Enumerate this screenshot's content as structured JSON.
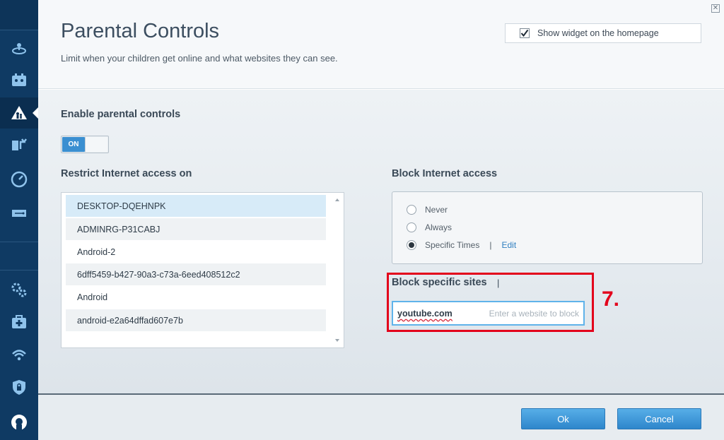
{
  "sidebar": {
    "items": [
      {
        "icon": "network-map-icon"
      },
      {
        "icon": "guest-access-icon"
      },
      {
        "icon": "parental-controls-icon",
        "active": true
      },
      {
        "icon": "media-prioritization-icon"
      },
      {
        "icon": "speed-test-icon"
      },
      {
        "icon": "external-storage-icon"
      },
      {
        "icon": "connectivity-settings-icon"
      },
      {
        "icon": "troubleshooting-icon"
      },
      {
        "icon": "wireless-icon"
      },
      {
        "icon": "security-icon"
      },
      {
        "icon": "linksys-logo-icon"
      }
    ]
  },
  "header": {
    "title": "Parental Controls",
    "subtitle": "Limit when your children get online and what websites they can see.",
    "widget_label": "Show widget on the homepage",
    "widget_checked": true
  },
  "enable": {
    "label": "Enable parental controls",
    "toggle_text": "ON"
  },
  "restrict": {
    "label": "Restrict Internet access on",
    "devices": [
      "DESKTOP-DQEHNPK",
      "ADMINRG-P31CABJ",
      "Android-2",
      "6dff5459-b427-90a3-c73a-6eed408512c2",
      "Android",
      "android-e2a64dffad607e7b"
    ],
    "selected_index": 0
  },
  "block": {
    "label": "Block Internet access",
    "options": [
      "Never",
      "Always",
      "Specific Times"
    ],
    "selected": "Specific Times",
    "edit_label": "Edit"
  },
  "sites": {
    "label": "Block specific sites",
    "cursor": "|",
    "value": "youtube.com",
    "placeholder": "Enter a website to block"
  },
  "annotation": {
    "step": "7."
  },
  "footer": {
    "ok_label": "Ok",
    "cancel_label": "Cancel"
  },
  "colors": {
    "sidebar": "#0f3a63",
    "accent": "#2e86cb",
    "highlight": "#e3001b"
  }
}
